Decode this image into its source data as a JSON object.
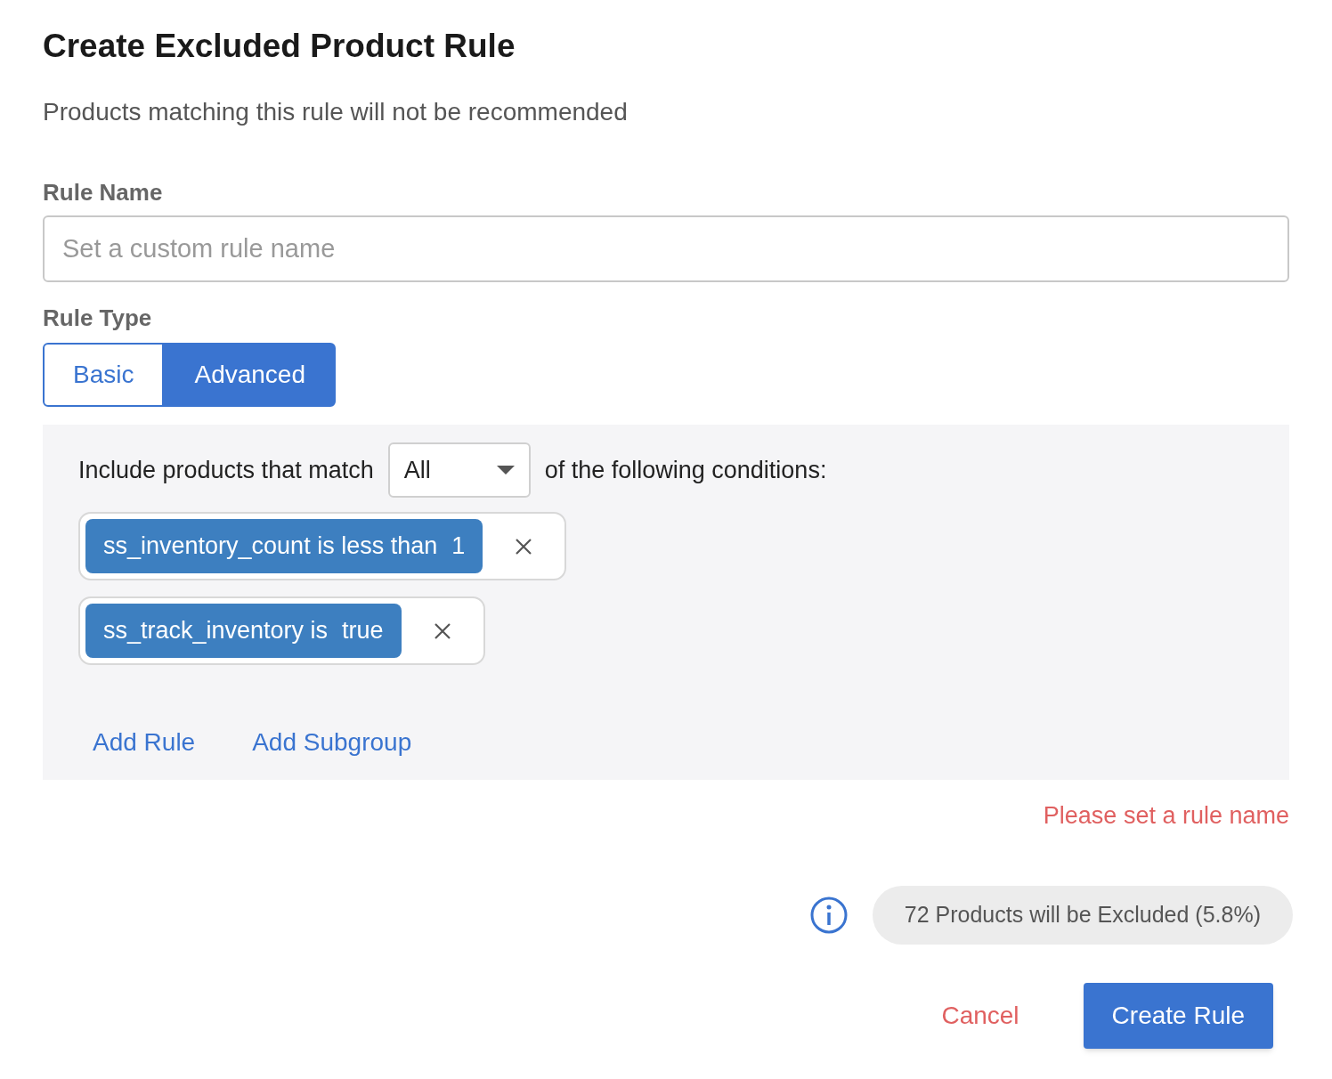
{
  "title": "Create Excluded Product Rule",
  "subtitle": "Products matching this rule will not be recommended",
  "rule_name": {
    "label": "Rule Name",
    "placeholder": "Set a custom rule name"
  },
  "rule_type": {
    "label": "Rule Type",
    "options": [
      {
        "label": "Basic",
        "selected": false
      },
      {
        "label": "Advanced",
        "selected": true
      }
    ]
  },
  "conditions": {
    "prefix": "Include products that match",
    "match": "All",
    "suffix": "of the following conditions:",
    "rules": [
      {
        "text": "ss_inventory_count is less than",
        "value": "1"
      },
      {
        "text": "ss_track_inventory is",
        "value": "true"
      }
    ],
    "actions": [
      "Add Rule",
      "Add Subgroup"
    ]
  },
  "error": "Please set a rule name",
  "summary": "72 Products will be Excluded (5.8%)",
  "buttons": [
    {
      "label": "Cancel",
      "kind": "text"
    },
    {
      "label": "Create Rule",
      "kind": "primary"
    }
  ]
}
